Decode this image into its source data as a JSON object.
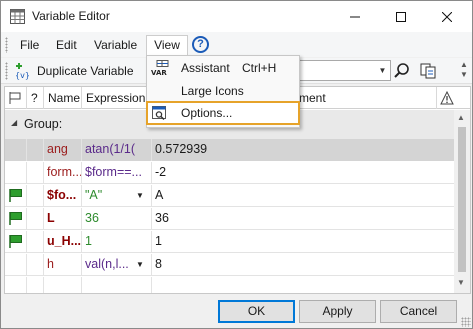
{
  "window": {
    "title": "Variable Editor"
  },
  "menubar": {
    "file": "File",
    "edit": "Edit",
    "variable": "Variable",
    "view": "View",
    "help": "?"
  },
  "toolbar": {
    "duplicate_label": "Duplicate Variable",
    "search_value": ""
  },
  "view_menu": {
    "items": [
      {
        "label": "Assistant",
        "shortcut": "Ctrl+H",
        "icon": "var-assistant-icon"
      },
      {
        "label": "Large Icons",
        "shortcut": "",
        "icon": ""
      },
      {
        "label": "Options...",
        "shortcut": "",
        "icon": "options-icon"
      }
    ],
    "highlight_color": "#e6a32a"
  },
  "grid": {
    "headers": {
      "flag": "",
      "q": "?",
      "name": "Name",
      "expression": "Expression",
      "comment": "ment",
      "warning": "!"
    },
    "group_label": "Group:",
    "rows": [
      {
        "flag": false,
        "name": "ang",
        "expression": "atan(1/1(",
        "value": "0.572939",
        "selected": true,
        "dropdown": false
      },
      {
        "flag": false,
        "name": "form...",
        "expression": "$form==...",
        "value": "-2",
        "selected": false,
        "dropdown": false
      },
      {
        "flag": true,
        "name": "$fo...",
        "expression": "\"A\"",
        "value": "A",
        "selected": false,
        "dropdown": true
      },
      {
        "flag": true,
        "name": "L",
        "expression": "36",
        "value": "36",
        "selected": false,
        "dropdown": false
      },
      {
        "flag": true,
        "name": "u_H...",
        "expression": "1",
        "value": "1",
        "selected": false,
        "dropdown": false
      },
      {
        "flag": false,
        "name": "h",
        "expression": "val(n,l...",
        "value": "8",
        "selected": false,
        "dropdown": true
      }
    ]
  },
  "buttons": {
    "ok": "OK",
    "apply": "Apply",
    "cancel": "Cancel"
  },
  "colors": {
    "accent": "#0078d7",
    "flag_green": "#2e9e2e",
    "name_red": "#8b0000",
    "expr_purple": "#5a2a8a",
    "expr_green": "#2e8b2e"
  }
}
